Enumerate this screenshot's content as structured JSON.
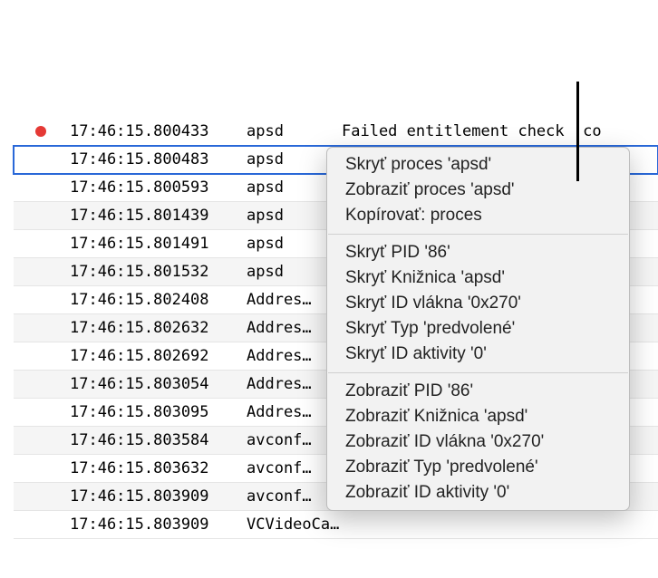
{
  "rows": [
    {
      "dot": true,
      "time": "17:46:15.800433",
      "proc": "apsd",
      "msg": "Failed entitlement check 'co",
      "selected": false
    },
    {
      "dot": false,
      "time": "17:46:15.800483",
      "proc": "apsd",
      "msg": "",
      "selected": true
    },
    {
      "dot": false,
      "time": "17:46:15.800593",
      "proc": "apsd",
      "msg": "",
      "selected": false
    },
    {
      "dot": false,
      "time": "17:46:15.801439",
      "proc": "apsd",
      "msg": "",
      "selected": false
    },
    {
      "dot": false,
      "time": "17:46:15.801491",
      "proc": "apsd",
      "msg": "",
      "selected": false
    },
    {
      "dot": false,
      "time": "17:46:15.801532",
      "proc": "apsd",
      "msg": "",
      "selected": false
    },
    {
      "dot": false,
      "time": "17:46:15.802408",
      "proc": "Addres…",
      "msg": "",
      "selected": false
    },
    {
      "dot": false,
      "time": "17:46:15.802632",
      "proc": "Addres…",
      "msg": "",
      "selected": false
    },
    {
      "dot": false,
      "time": "17:46:15.802692",
      "proc": "Addres…",
      "msg": "",
      "selected": false
    },
    {
      "dot": false,
      "time": "17:46:15.803054",
      "proc": "Addres…",
      "msg": "",
      "selected": false
    },
    {
      "dot": false,
      "time": "17:46:15.803095",
      "proc": "Addres…",
      "msg": "",
      "selected": false
    },
    {
      "dot": false,
      "time": "17:46:15.803584",
      "proc": "avconf…",
      "msg": "",
      "selected": false
    },
    {
      "dot": false,
      "time": "17:46:15.803632",
      "proc": "avconf…",
      "msg": "",
      "selected": false
    },
    {
      "dot": false,
      "time": "17:46:15.803909",
      "proc": "avconf…",
      "msg": "",
      "selected": false
    },
    {
      "dot": false,
      "time": "17:46:15.803909",
      "proc": "VCVideoCaptureServer [INFO]…",
      "msg": "",
      "selected": false
    }
  ],
  "menu": {
    "group1": [
      "Skryť proces 'apsd'",
      "Zobraziť proces 'apsd'",
      "Kopírovať: proces"
    ],
    "group2": [
      "Skryť PID '86'",
      "Skryť Knižnica 'apsd'",
      "Skryť ID vlákna '0x270'",
      "Skryť Typ 'predvolené'",
      "Skryť ID aktivity '0'"
    ],
    "group3": [
      "Zobraziť PID '86'",
      "Zobraziť Knižnica 'apsd'",
      "Zobraziť ID vlákna '0x270'",
      "Zobraziť Typ 'predvolené'",
      "Zobraziť ID aktivity '0'"
    ]
  }
}
